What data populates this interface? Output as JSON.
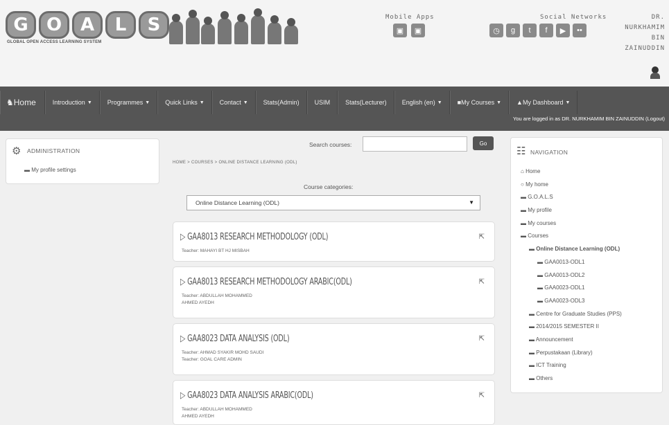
{
  "header": {
    "logo_letters": [
      "G",
      "O",
      "A",
      "L",
      "S"
    ],
    "logo_subtitle": "GLOBAL OPEN ACCESS LEARNING SYSTEM",
    "mobile_apps_title": "Mobile Apps",
    "social_title": "Social Networks",
    "user_name_lines": [
      "DR.",
      "NURKHAMIM",
      "BIN",
      "ZAINUDDIN"
    ]
  },
  "nav": {
    "items": [
      {
        "label": "Home",
        "caret": false
      },
      {
        "label": "Introduction",
        "caret": true
      },
      {
        "label": "Programmes",
        "caret": true
      },
      {
        "label": "Quick Links",
        "caret": true
      },
      {
        "label": "Contact",
        "caret": true
      },
      {
        "label": "Stats(Admin)",
        "caret": false
      },
      {
        "label": "USIM",
        "caret": false
      },
      {
        "label": "Stats(Lecturer)",
        "caret": false
      },
      {
        "label": "English (en)",
        "caret": true
      },
      {
        "label": "My Courses",
        "caret": true
      },
      {
        "label": "My Dashboard",
        "caret": true
      }
    ],
    "logged_in_text": "You are logged in as DR. NURKHAMIM BIN ZAINUDDIN (Logout)"
  },
  "admin_block": {
    "title": "ADMINISTRATION",
    "item": "My profile settings"
  },
  "search": {
    "label": "Search courses:",
    "value": "",
    "button": "Go"
  },
  "breadcrumb": "HOME > COURSES > ONLINE DISTANCE LEARNING (ODL)",
  "categories": {
    "label": "Course categories:",
    "selected": "Online Distance Learning (ODL)"
  },
  "courses": [
    {
      "title": "GAA8013 RESEARCH METHODOLOGY (ODL)",
      "teachers": [
        "Teacher: MAHAYI BT HJ MISBAH"
      ]
    },
    {
      "title": "GAA8013 RESEARCH METHODOLOGY ARABIC(ODL)",
      "teachers": [
        "Teacher: ABDULLAH MOHAMMED",
        "AHMED AYEDH"
      ]
    },
    {
      "title": "GAA8023 DATA ANALYSIS (ODL)",
      "teachers": [
        "Teacher: AHMAD SYAKIR MOHD SAUDI",
        "Teacher: GOAL CARE ADMIN"
      ]
    },
    {
      "title": "GAA8023 DATA ANALYSIS ARABIC(ODL)",
      "teachers": [
        "Teacher: ABDULLAH MOHAMMED",
        "AHMED AYEDH"
      ]
    }
  ],
  "navigation_block": {
    "title": "NAVIGATION",
    "items": [
      {
        "label": "Home",
        "icon": "home-icon",
        "indent": 0,
        "bold": false
      },
      {
        "label": "My home",
        "icon": "circle-icon",
        "indent": 0,
        "bold": false
      },
      {
        "label": "G.O.A.L.S",
        "icon": "folder-icon",
        "indent": 0,
        "bold": false
      },
      {
        "label": "My profile",
        "icon": "folder-icon",
        "indent": 0,
        "bold": false
      },
      {
        "label": "My courses",
        "icon": "folder-icon",
        "indent": 0,
        "bold": false
      },
      {
        "label": "Courses",
        "icon": "folder-icon",
        "indent": 0,
        "bold": false
      },
      {
        "label": "Online Distance Learning (ODL)",
        "icon": "folder-icon",
        "indent": 1,
        "bold": true
      },
      {
        "label": "GAA0013-ODL1",
        "icon": "folder-icon",
        "indent": 2,
        "bold": false
      },
      {
        "label": "GAA0013-ODL2",
        "icon": "folder-icon",
        "indent": 2,
        "bold": false
      },
      {
        "label": "GAA0023-ODL1",
        "icon": "folder-icon",
        "indent": 2,
        "bold": false
      },
      {
        "label": "GAA0023-ODL3",
        "icon": "folder-icon",
        "indent": 2,
        "bold": false
      },
      {
        "label": "Centre for Graduate Studies (PPS)",
        "icon": "folder-icon",
        "indent": 1,
        "bold": false
      },
      {
        "label": "2014/2015 SEMESTER II",
        "icon": "folder-icon",
        "indent": 1,
        "bold": false
      },
      {
        "label": "Announcement",
        "icon": "folder-icon",
        "indent": 1,
        "bold": false
      },
      {
        "label": "Perpustakaan (Library)",
        "icon": "folder-icon",
        "indent": 1,
        "bold": false
      },
      {
        "label": "ICT Training",
        "icon": "folder-icon",
        "indent": 1,
        "bold": false
      },
      {
        "label": "Others",
        "icon": "folder-icon",
        "indent": 1,
        "bold": false
      }
    ]
  }
}
